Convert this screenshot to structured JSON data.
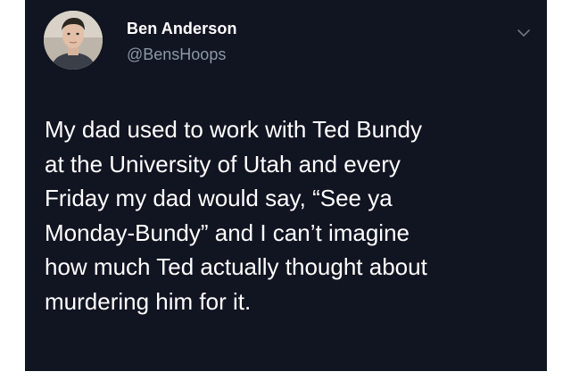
{
  "tweet": {
    "author": {
      "display_name": "Ben Anderson",
      "handle": "@BensHoops",
      "avatar_icon": "profile-photo"
    },
    "text": "My dad used to work with Ted Bundy\nat the University of Utah and every\nFriday my dad would say, “See ya\nMonday-Bundy” and I can’t imagine\nhow much Ted actually thought about\nmurdering him for it.",
    "menu_icon": "chevron-down-icon"
  },
  "colors": {
    "card_background": "#111421",
    "text_primary": "#ffffff",
    "text_secondary": "#8b98a5",
    "page_background": "#ffffff"
  }
}
